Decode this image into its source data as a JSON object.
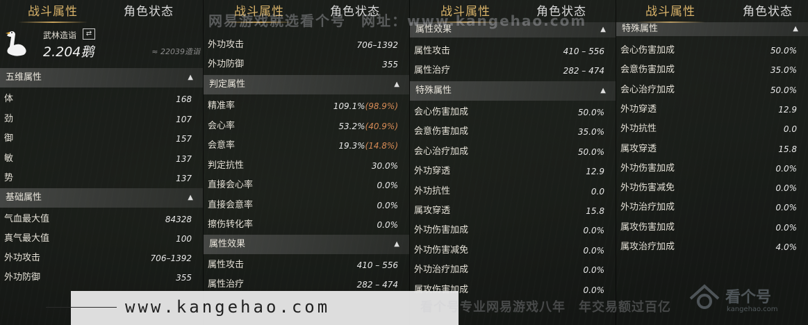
{
  "tabs": {
    "battle": "战斗属性",
    "role": "角色状态"
  },
  "colors": {
    "accent": "#d9b36a",
    "extra": "#d58a55"
  },
  "panel1": {
    "rank_title": "武林造诣",
    "rank_value": "2.204鹅",
    "rank_compare": "≈ 22039造诣",
    "sections": {
      "wuwei": "五维属性",
      "jichu": "基础属性"
    },
    "wuwei": [
      {
        "label": "体",
        "value": "168"
      },
      {
        "label": "劲",
        "value": "107"
      },
      {
        "label": "御",
        "value": "157"
      },
      {
        "label": "敏",
        "value": "137"
      },
      {
        "label": "势",
        "value": "137"
      }
    ],
    "jichu": [
      {
        "label": "气血最大值",
        "value": "84328"
      },
      {
        "label": "真气最大值",
        "value": "100"
      },
      {
        "label": "外功攻击",
        "value": "706–1392"
      },
      {
        "label": "外功防御",
        "value": "355"
      }
    ]
  },
  "panel2": {
    "top": [
      {
        "label": "外功攻击",
        "value": "706–1392"
      },
      {
        "label": "外功防御",
        "value": "355"
      }
    ],
    "sections": {
      "panding": "判定属性",
      "xiaoguo": "属性效果"
    },
    "panding": [
      {
        "label": "精准率",
        "value": "109.1%",
        "extra": "(98.9%)"
      },
      {
        "label": "会心率",
        "value": "53.2%",
        "extra": "(40.9%)"
      },
      {
        "label": "会意率",
        "value": "19.3%",
        "extra": "(14.8%)"
      },
      {
        "label": "判定抗性",
        "value": "30.0%",
        "extra": ""
      },
      {
        "label": "直接会心率",
        "value": "0.0%",
        "extra": ""
      },
      {
        "label": "直接会意率",
        "value": "0.0%",
        "extra": ""
      },
      {
        "label": "擦伤转化率",
        "value": "0.0%",
        "extra": ""
      }
    ],
    "xiaoguo": [
      {
        "label": "属性攻击",
        "value": "410 – 556"
      },
      {
        "label": "属性治疗",
        "value": "282 – 474"
      }
    ]
  },
  "panel3": {
    "top_section": "属性效果",
    "top": [
      {
        "label": "属性攻击",
        "value": "410 – 556"
      },
      {
        "label": "属性治疗",
        "value": "282 – 474"
      }
    ],
    "section": "特殊属性",
    "special": [
      {
        "label": "会心伤害加成",
        "value": "50.0%"
      },
      {
        "label": "会意伤害加成",
        "value": "35.0%"
      },
      {
        "label": "会心治疗加成",
        "value": "50.0%"
      },
      {
        "label": "外功穿透",
        "value": "12.9"
      },
      {
        "label": "外功抗性",
        "value": "0.0"
      },
      {
        "label": "属攻穿透",
        "value": "15.8"
      },
      {
        "label": "外功伤害加成",
        "value": "0.0%"
      },
      {
        "label": "外功伤害减免",
        "value": "0.0%"
      },
      {
        "label": "外功治疗加成",
        "value": "0.0%"
      },
      {
        "label": "属攻伤害加成",
        "value": "0.0%"
      }
    ]
  },
  "panel4": {
    "section": "特殊属性",
    "special": [
      {
        "label": "会心伤害加成",
        "value": "50.0%"
      },
      {
        "label": "会意伤害加成",
        "value": "35.0%"
      },
      {
        "label": "会心治疗加成",
        "value": "50.0%"
      },
      {
        "label": "外功穿透",
        "value": "12.9"
      },
      {
        "label": "外功抗性",
        "value": "0.0"
      },
      {
        "label": "属攻穿透",
        "value": "15.8"
      },
      {
        "label": "外功伤害加成",
        "value": "0.0%"
      },
      {
        "label": "外功伤害减免",
        "value": "0.0%"
      },
      {
        "label": "外功治疗加成",
        "value": "0.0%"
      },
      {
        "label": "属攻伤害加成",
        "value": "0.0%"
      },
      {
        "label": "属攻治疗加成",
        "value": "4.0%"
      }
    ]
  },
  "watermarks": {
    "top": "网易游戏就选看个号　网址：www.kangehao.com",
    "url": "www.kangehao.com",
    "mid": "看个号专业网易游戏八年　年交易额过百亿",
    "logo_cn": "看个号",
    "logo_en": "kangehao.com"
  },
  "icons": {
    "goose": "goose-icon",
    "swap": "swap-icon",
    "collapse": "caret-up-icon"
  }
}
